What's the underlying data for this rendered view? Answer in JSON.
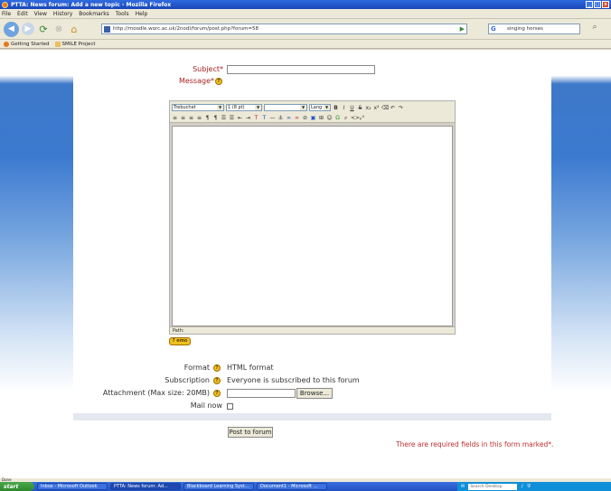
{
  "window": {
    "title": "PTTA: News forum: Add a new topic - Mozilla Firefox",
    "min": "_",
    "max": "□",
    "close": "x"
  },
  "menu": [
    "File",
    "Edit",
    "View",
    "History",
    "Bookmarks",
    "Tools",
    "Help"
  ],
  "nav": {
    "url": "http://moodle.worc.ac.uk/2nodl/forum/post.php?forum=58",
    "search_value": "singing horses"
  },
  "bookmarks": [
    "Getting Started",
    "SMILE Project"
  ],
  "form": {
    "subject_label": "Subject*",
    "message_label": "Message*",
    "help_glyph": "?",
    "editor": {
      "font": "Trebuchet",
      "size": "1 (8 pt)",
      "style": "",
      "lang": "Lang",
      "path_label": "Path:"
    },
    "editor_help_label": "?  emo",
    "format_label": "Format",
    "format_value": "HTML format",
    "subscription_label": "Subscription",
    "subscription_value": "Everyone is subscribed to this forum",
    "attachment_label": "Attachment (Max size: 20MB)",
    "browse_label": "Browse...",
    "mailnow_label": "Mail now",
    "post_label": "Post to forum",
    "required_note": "There are required fields in this form marked*."
  },
  "status": "Done",
  "taskbar": {
    "start": "start",
    "tasks": [
      "Inbox - Microsoft Outlook",
      "PTTA: News forum: Ad...",
      "Blackboard Learning Syst...",
      "Document1 - Microsoft ..."
    ],
    "search_placeholder": "Search Desktop"
  },
  "colors": {
    "required": "#aa2222",
    "help": "#f0c020",
    "page_bg": "#3c7ad0"
  }
}
